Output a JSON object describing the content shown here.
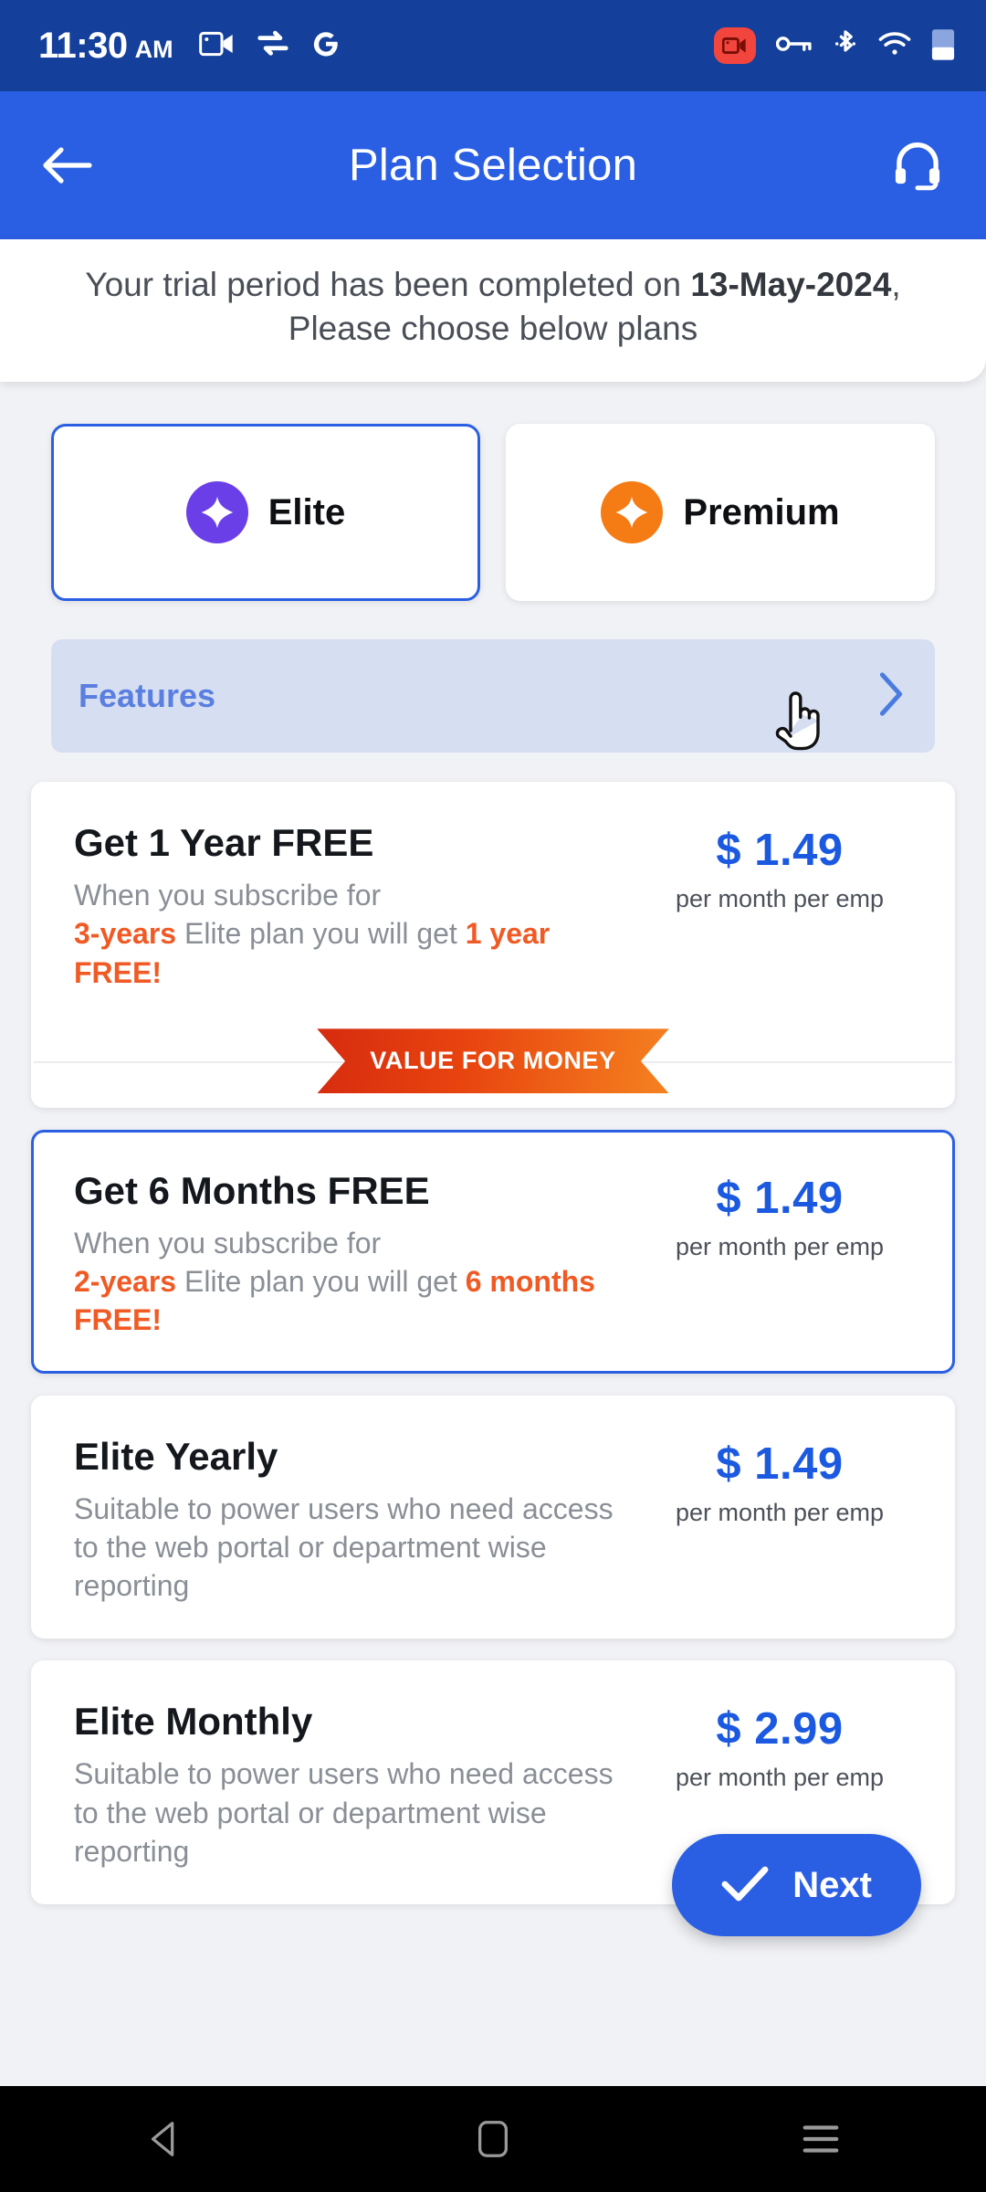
{
  "statusbar": {
    "time": "11:30",
    "ampm": "AM",
    "icons_left": [
      "video-call-icon",
      "sync-transfer-icon",
      "google-g-icon"
    ],
    "icons_right": [
      "screen-record-icon",
      "vpn-key-icon",
      "bluetooth-icon",
      "wifi-icon",
      "battery-icon"
    ],
    "record_badge_color": "#F2453D",
    "background": "#14409B"
  },
  "appbar": {
    "title": "Plan Selection",
    "back_icon": "arrow-left-icon",
    "support_icon": "headset-icon",
    "background": "#2B5FE3"
  },
  "banner": {
    "prefix": "Your trial period has been completed on ",
    "date": "13-May-2024",
    "suffix": ", Please choose below plans"
  },
  "plan_tabs": [
    {
      "label": "Elite",
      "icon": "sparkle-badge-icon",
      "color": "#6B3FE8",
      "selected": true
    },
    {
      "label": "Premium",
      "icon": "sparkle-badge-icon",
      "color": "#F57C14",
      "selected": false
    }
  ],
  "features_row": {
    "label": "Features",
    "chevron_icon": "chevron-right-icon",
    "cursor": "hand-pointer-cursor"
  },
  "plans": [
    {
      "title": "Get 1 Year FREE",
      "desc_plain_1": "When you subscribe for",
      "desc_hl_1": "3-years",
      "desc_plain_2": " Elite plan you will get ",
      "desc_hl_2": "1 year FREE!",
      "price": "$ 1.49",
      "price_sub": "per month per emp",
      "ribbon": "VALUE FOR MONEY",
      "selected": false
    },
    {
      "title": "Get 6 Months FREE",
      "desc_plain_1": "When you subscribe for",
      "desc_hl_1": "2-years",
      "desc_plain_2": " Elite plan you will get ",
      "desc_hl_2": "6 months FREE!",
      "price": "$ 1.49",
      "price_sub": "per month per emp",
      "ribbon": "",
      "selected": true
    },
    {
      "title": "Elite Yearly",
      "desc_plain_1": "Suitable to power users who need access to the web portal or department wise reporting",
      "desc_hl_1": "",
      "desc_plain_2": "",
      "desc_hl_2": "",
      "price": "$ 1.49",
      "price_sub": "per month per emp",
      "ribbon": "",
      "selected": false
    },
    {
      "title": "Elite Monthly",
      "desc_plain_1": "Suitable to power users who need access to the web portal or department wise reporting",
      "desc_hl_1": "",
      "desc_plain_2": "",
      "desc_hl_2": "",
      "price": "$ 2.99",
      "price_sub": "per month per emp",
      "ribbon": "",
      "selected": false
    }
  ],
  "next_button": {
    "label": "Next",
    "icon": "check-icon",
    "color": "#2B5FE3"
  },
  "navbar": {
    "back_icon": "triangle-back-icon",
    "home_icon": "home-square-icon",
    "recents_icon": "recents-lines-icon"
  },
  "colors": {
    "page_bg": "#F1F2F5",
    "accent_blue": "#2B5FE3",
    "price_blue": "#1B5AE0",
    "highlight_orange": "#F05A24",
    "features_bg": "#D6DEF2"
  }
}
